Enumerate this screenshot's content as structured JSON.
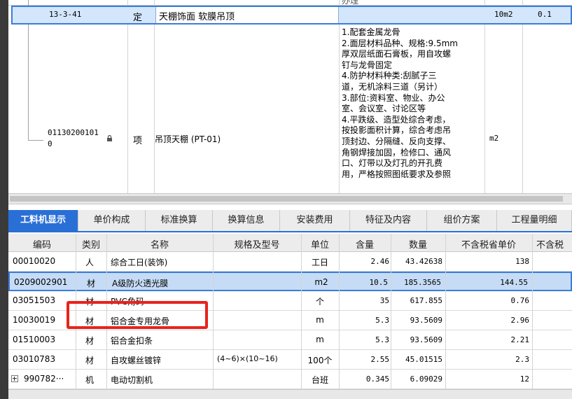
{
  "top_grid": {
    "partial_text": "办理",
    "row1": {
      "code": "13-3-41",
      "type": "定",
      "name": "天棚饰面 软膜吊顶",
      "unit": "10m2",
      "qty": "0.1"
    },
    "row2": {
      "code_line1": "01130200101",
      "code_line2": "0",
      "type": "项",
      "name": "吊顶天棚 (PT-01)",
      "unit": "m2",
      "desc_lines": [
        "1.配套金属龙骨",
        "2.面层材料品种、规格:9.5mm",
        "厚双层纸面石膏板，用自攻螺",
        "钉与龙骨固定",
        "4.防护材料种类:刮腻子三",
        "道，无机涂料三道（另计）",
        "3.部位:资料室、物业、办公",
        "室、会议室、讨论区等",
        "4.平跌级、造型处综合考虑，",
        "按投影面积计算，综合考虑吊",
        "顶封边、分隔缝、反向支撑、",
        "角钢焊接加固，检修口、通风",
        "口、灯带以及灯孔的开孔费",
        "用，严格按照图纸要求及参照"
      ]
    }
  },
  "tabs": [
    "工料机显示",
    "单价构成",
    "标准换算",
    "换算信息",
    "安装费用",
    "特征及内容",
    "组价方案",
    "工程量明细"
  ],
  "table": {
    "headers": [
      "编码",
      "类别",
      "名称",
      "规格及型号",
      "单位",
      "含量",
      "数量",
      "不含税省单价",
      "不含税"
    ],
    "rows": [
      {
        "code": "00010020",
        "cat": "人",
        "name": "综合工日(装饰)",
        "spec": "",
        "unit": "工日",
        "content": "2.46",
        "qty": "43.42638",
        "price": "138"
      },
      {
        "code": "0209002901",
        "cat": "材",
        "name": "A级防火透光膜",
        "spec": "",
        "unit": "m2",
        "content": "10.5",
        "qty": "185.3565",
        "price": "144.55"
      },
      {
        "code": "03051503",
        "cat": "材",
        "name": "PVC角码",
        "spec": "",
        "unit": "个",
        "content": "35",
        "qty": "617.855",
        "price": "0.76"
      },
      {
        "code": "10030019",
        "cat": "材",
        "name": "铝合金专用龙骨",
        "spec": "",
        "unit": "m",
        "content": "5.3",
        "qty": "93.5609",
        "price": "2.96"
      },
      {
        "code": "01510003",
        "cat": "材",
        "name": "铝合金扣条",
        "spec": "",
        "unit": "m",
        "content": "5.3",
        "qty": "93.5609",
        "price": "2.21"
      },
      {
        "code": "03010783",
        "cat": "材",
        "name": "自攻螺丝镀锌",
        "spec": "(4~6)×(10~16)",
        "unit": "100个",
        "content": "2.55",
        "qty": "45.01515",
        "price": "2.3"
      },
      {
        "code": "990782···",
        "cat": "机",
        "name": "电动切割机",
        "spec": "",
        "unit": "台班",
        "content": "0.345",
        "qty": "6.09029",
        "price": "12"
      }
    ]
  }
}
